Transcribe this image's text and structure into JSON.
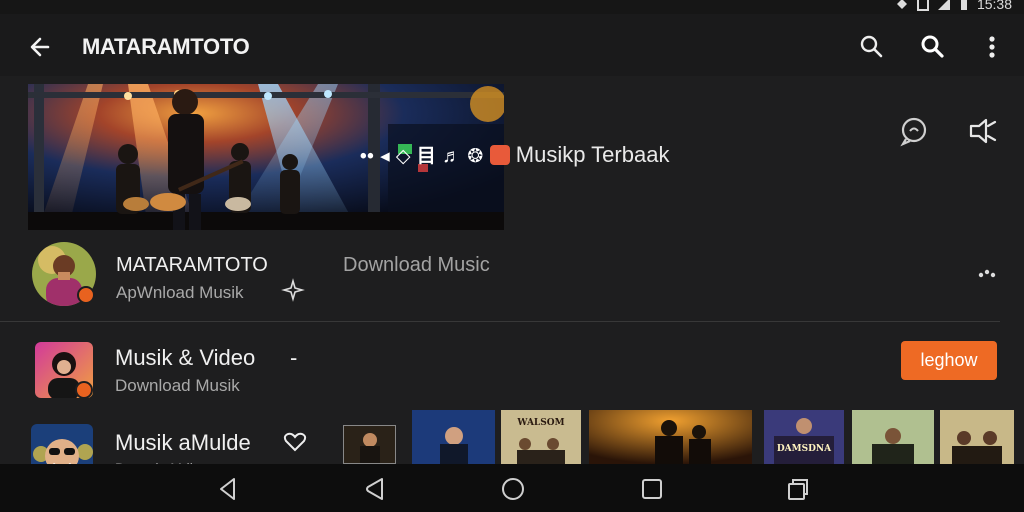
{
  "status_bar": {
    "time": "15:38",
    "icons": [
      "signal-icon",
      "sim-icon",
      "wifi-icon",
      "battery-icon"
    ]
  },
  "app_bar": {
    "title": "MATARAMTOTO",
    "icons": [
      "back-arrow-icon",
      "search-icon",
      "search-icon",
      "more-vert-icon"
    ]
  },
  "banner": {
    "glyphs": "•• ◂ ◇ 目 ♬ ❂",
    "caption": "Musikp Terbaak",
    "side_icons": [
      "comment-icon",
      "share-icon"
    ]
  },
  "rows": [
    {
      "title": "MATARAMTOTO",
      "subtitle": "ApWnload Musik",
      "extra_text": "Download Music",
      "icons": [
        "sparkle-icon",
        "overflow-icon"
      ]
    },
    {
      "title": "Musik & Video",
      "title_suffix": "-",
      "subtitle": "Download Musik",
      "action_label": "leghow"
    },
    {
      "title": "Musik aMulde",
      "subtitle": "Downd uMdiop",
      "icons": [
        "heart-icon"
      ]
    }
  ],
  "thumbnails": [
    {
      "label": ""
    },
    {
      "label": ""
    },
    {
      "label": "WALSOM"
    },
    {
      "label": ""
    },
    {
      "label": "DAMSDNA"
    },
    {
      "label": ""
    },
    {
      "label": ""
    }
  ],
  "colors": {
    "accent": "#ee6a24",
    "background": "#1e1e1f",
    "app_bar": "#1a1a1b",
    "nav_bar": "#0d0d0d"
  },
  "nav_bar": {
    "icons": [
      "back-triangle-icon",
      "back-alt-icon",
      "home-circle-icon",
      "recents-square-icon",
      "recents-alt-icon"
    ]
  }
}
